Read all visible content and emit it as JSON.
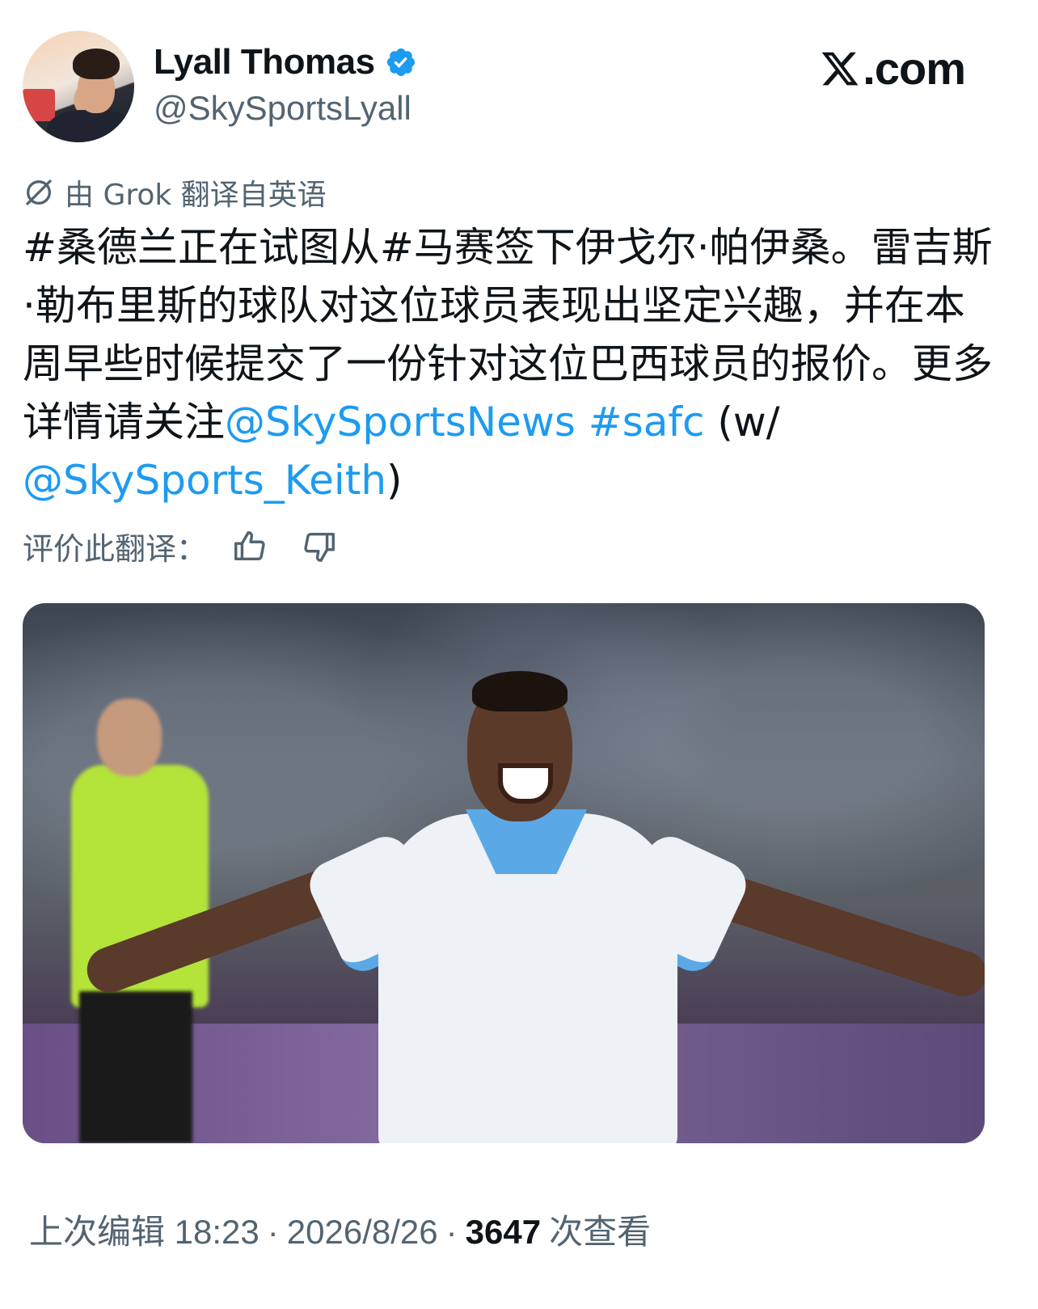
{
  "author": {
    "display_name": "Lyall Thomas",
    "handle": "@SkySportsLyall",
    "verified": true
  },
  "site": {
    "label": ".com"
  },
  "translation": {
    "note": "由 Grok 翻译自英语",
    "rate_label": "评价此翻译："
  },
  "tweet": {
    "text_part1": "#桑德兰正在试图从#马赛签下伊戈尔·帕伊桑。雷吉斯·勒布里斯的球队对这位球员表现出坚定兴趣，并在本周早些时候提交了一份针对这位巴西球员的报价。更多详情请关注",
    "mention1": "@SkySportsNews",
    "hashtag": "#safc",
    "text_part2": " (w/ ",
    "mention2": "@SkySports_Keith",
    "text_part3": ")"
  },
  "footer": {
    "edited_label": "上次编辑 18:23",
    "date": "2026/8/26",
    "views_count": "3647",
    "views_label": "次查看"
  },
  "colors": {
    "link": "#1d9bf0",
    "muted": "#536471",
    "text": "#0f1419",
    "verified": "#1d9bf0"
  }
}
